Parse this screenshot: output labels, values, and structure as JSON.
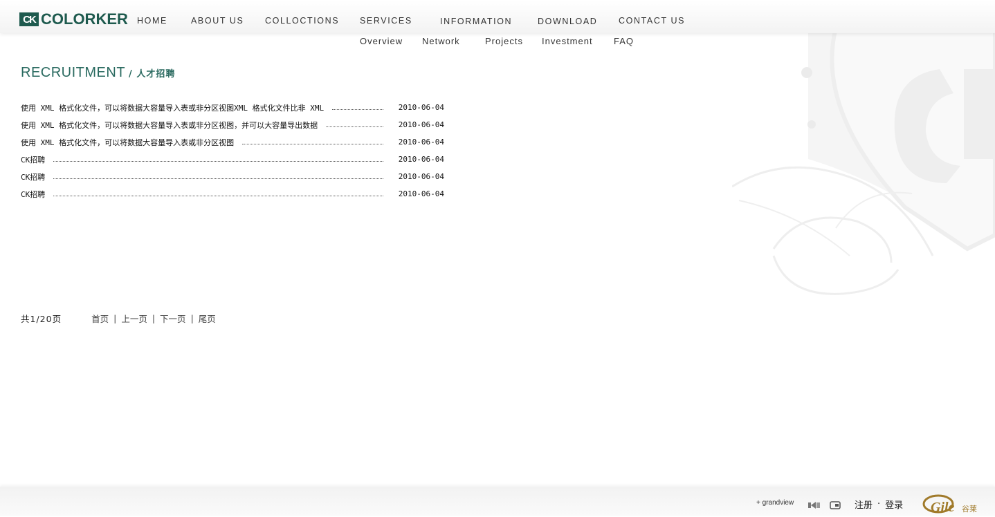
{
  "brand": {
    "logo_mark": "CK",
    "logo_text": "COLORKER"
  },
  "nav": {
    "main": [
      "HOME",
      "ABOUT US",
      "COLLOCTIONS",
      "SERVICES",
      "INFORMATION",
      "DOWNLOAD",
      "CONTACT US"
    ],
    "sub": [
      "Overview",
      "Network",
      "Projects",
      "Investment",
      "FAQ"
    ]
  },
  "page": {
    "title_en": "RECRUITMENT",
    "title_cn": "/ 人才招聘"
  },
  "list": [
    {
      "title": "使用 XML 格式化文件，可以将数据大容量导入表或非分区视图XML 格式化文件比非 XML",
      "date": "2010-06-04"
    },
    {
      "title": "使用 XML 格式化文件，可以将数据大容量导入表或非分区视图，并可以大容量导出数据",
      "date": "2010-06-04"
    },
    {
      "title": "使用 XML 格式化文件，可以将数据大容量导入表或非分区视图",
      "date": "2010-06-04"
    },
    {
      "title": "CK招聘",
      "date": "2010-06-04"
    },
    {
      "title": "CK招聘",
      "date": "2010-06-04"
    },
    {
      "title": "CK招聘",
      "date": "2010-06-04"
    }
  ],
  "pager": {
    "count": "共1/20页",
    "first": "首页",
    "prev": "上一页",
    "next": "下一页",
    "last": "尾页",
    "separator": "|"
  },
  "footer": {
    "credit": "+ grandview",
    "register": "注册",
    "dot": "·",
    "login": "登录",
    "partner_logo_text": "Gile",
    "partner_logo_cn": "谷莱"
  },
  "icons": {
    "film": "film-icon",
    "window": "window-icon"
  },
  "colors": {
    "brand": "#1e5a4e",
    "title": "#2a6a60",
    "partner": "#a07a2a"
  }
}
